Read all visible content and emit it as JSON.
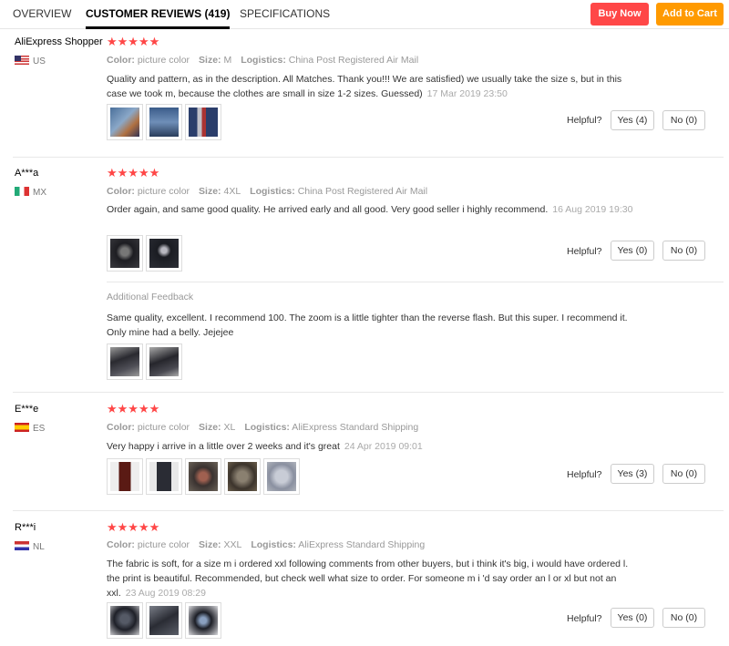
{
  "tabs": [
    {
      "label": "OVERVIEW"
    },
    {
      "label": "CUSTOMER REVIEWS (419)"
    },
    {
      "label": "SPECIFICATIONS"
    }
  ],
  "actions": {
    "buy_now": "Buy Now",
    "add_to_cart": "Add to Cart"
  },
  "labels": {
    "color": "Color:",
    "size": "Size:",
    "logistics": "Logistics:",
    "helpful": "Helpful?",
    "additional_feedback": "Additional Feedback",
    "stars": "★★★★★"
  },
  "reviews": [
    {
      "name": "AliExpress Shopper",
      "country": "US",
      "flag_icon": "us-flag-icon",
      "rating": 5,
      "color": "picture color",
      "size": "M",
      "logistics": "China Post Registered Air Mail",
      "text": "Quality and pattern, as in the description. All Matches. Thank you!!! We are satisfied) we usually take the size s, but in this case we took m, because the clothes are small in size 1-2 sizes. Guessed)",
      "date": "17 Mar 2019 23:50",
      "yes": "Yes (4)",
      "no": "No (0)"
    },
    {
      "name": "A***a",
      "country": "MX",
      "flag_icon": "mexico-flag-icon",
      "rating": 5,
      "color": "picture color",
      "size": "4XL",
      "logistics": "China Post Registered Air Mail",
      "text": "Order again, and same good quality. He arrived early and all good. Very good seller i highly recommend.",
      "date": "16 Aug 2019 19:30",
      "yes": "Yes (0)",
      "no": "No (0)",
      "additional_text": "Same quality, excellent. I recommend 100. The zoom is a little tighter than the reverse flash. But this super. I recommend it. Only mine had a belly. Jejejee"
    },
    {
      "name": "E***e",
      "country": "ES",
      "flag_icon": "spain-flag-icon",
      "rating": 5,
      "color": "picture color",
      "size": "XL",
      "logistics": "AliExpress Standard Shipping",
      "text": "Very happy i arrive in a little over 2 weeks and it's great",
      "date": "24 Apr 2019 09:01",
      "yes": "Yes (3)",
      "no": "No (0)"
    },
    {
      "name": "R***i",
      "country": "NL",
      "flag_icon": "netherlands-flag-icon",
      "rating": 5,
      "color": "picture color",
      "size": "XXL",
      "logistics": "AliExpress Standard Shipping",
      "text": "The fabric is soft, for a size m i ordered xxl following comments from other buyers, but i think it's big, i would have ordered l. the print is beautiful. Recommended, but check well what size to order. For someone m i 'd say order an l or xl but not an xxl.",
      "date": "23 Aug 2019 08:29",
      "yes": "Yes (0)",
      "no": "No (0)"
    }
  ]
}
